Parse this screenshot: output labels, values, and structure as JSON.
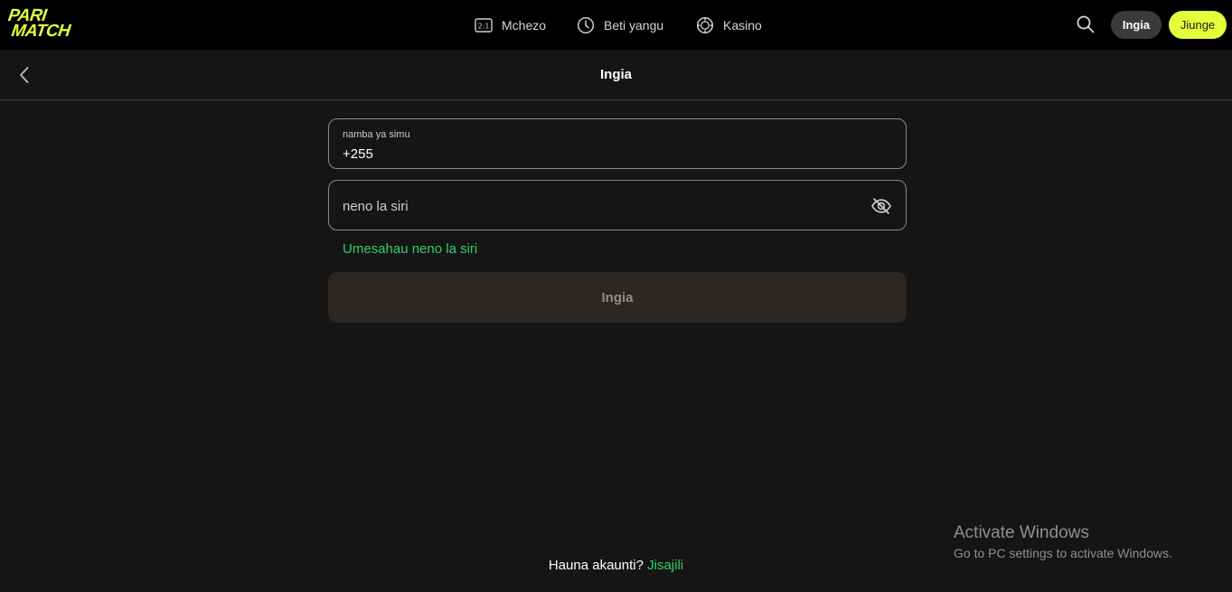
{
  "brand": {
    "logo_line1": "PARI",
    "logo_line2": "MATCH",
    "accent_color": "#e4ff3a",
    "link_color": "#2ed06e"
  },
  "topnav": {
    "items": [
      {
        "label": "Mchezo",
        "icon": "scoreboard-icon",
        "icon_text": "2:1"
      },
      {
        "label": "Beti yangu",
        "icon": "clock-icon"
      },
      {
        "label": "Kasino",
        "icon": "casino-chip-icon"
      }
    ],
    "search_icon": "search-icon",
    "login_label": "Ingia",
    "join_label": "Jiunge"
  },
  "subheader": {
    "back_icon": "chevron-left-icon",
    "title": "Ingia"
  },
  "form": {
    "phone_label": "namba ya simu",
    "phone_value": "+255",
    "password_placeholder": "neno la siri",
    "password_toggle_icon": "eye-off-icon",
    "forgot_label": "Umesahau neno la siri",
    "submit_label": "Ingia"
  },
  "footer": {
    "prompt": "Hauna akaunti?",
    "signup_label": "Jisajili"
  },
  "watermark": {
    "title": "Activate Windows",
    "subtitle": "Go to PC settings to activate Windows."
  }
}
